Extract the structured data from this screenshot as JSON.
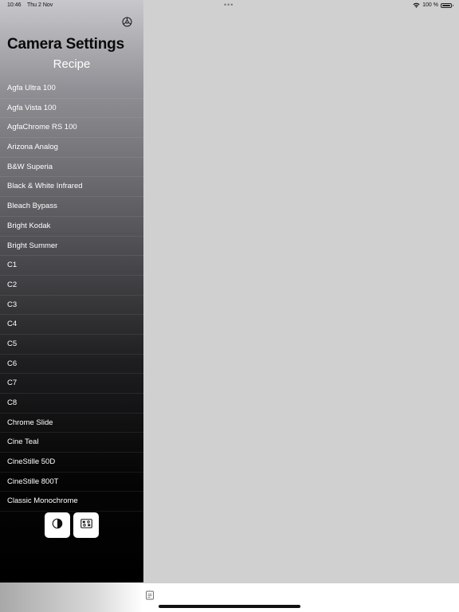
{
  "status_bar": {
    "time": "10:46",
    "date": "Thu 2 Nov",
    "dots": "•••",
    "battery_text": "100 %"
  },
  "sidebar": {
    "title": "Camera Settings",
    "subtitle": "Recipe",
    "recipes": [
      "Agfa Ultra 100",
      "Agfa Vista 100",
      "AgfaChrome RS 100",
      "Arizona Analog",
      "B&W Superia",
      "Black & White Infrared",
      "Bleach Bypass",
      "Bright Kodak",
      "Bright Summer",
      "C1",
      "C2",
      "C3",
      "C4",
      "C5",
      "C6",
      "C7",
      "C8",
      "Chrome Slide",
      "Cine Teal",
      "CineStille 50D",
      "CineStille 800T",
      "Classic Monochrome"
    ]
  },
  "icons": {
    "settings": "settings-icon",
    "contrast": "contrast-icon",
    "filter": "filter-icon",
    "document": "document-icon",
    "wifi": "wifi-icon",
    "battery": "battery-icon"
  },
  "colors": {
    "detail_background": "#d0d0d0",
    "sidebar_top": "#c8c8cc",
    "sidebar_bottom": "#000000",
    "title": "#0a0a0a",
    "list_text": "#ffffff",
    "button_background": "#ffffff"
  }
}
